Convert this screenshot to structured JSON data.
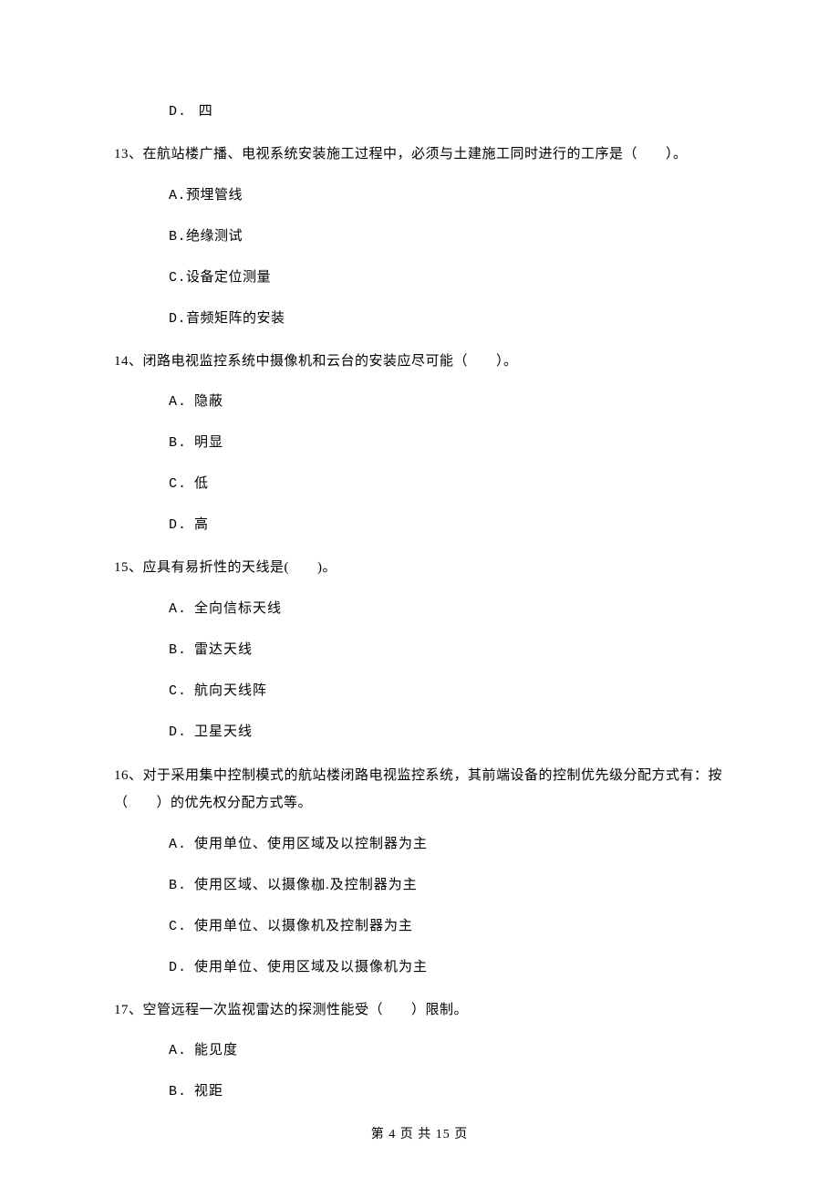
{
  "orphan_option": {
    "label": "D.",
    "text": "四"
  },
  "questions": [
    {
      "number": "13、",
      "text": "在航站楼广播、电视系统安装施工过程中，必须与土建施工同时进行的工序是（　　）。",
      "options": [
        {
          "label": "A.",
          "text": "预埋管线",
          "nospace": true
        },
        {
          "label": "B.",
          "text": "绝缘测试",
          "nospace": true
        },
        {
          "label": "C.",
          "text": "设备定位测量",
          "nospace": true
        },
        {
          "label": "D.",
          "text": "音频矩阵的安装",
          "nospace": true
        }
      ]
    },
    {
      "number": "14、",
      "text": "闭路电视监控系统中摄像机和云台的安装应尽可能（　　）。",
      "options": [
        {
          "label": "A.",
          "text": "隐蔽"
        },
        {
          "label": "B.",
          "text": "明显"
        },
        {
          "label": "C.",
          "text": "低"
        },
        {
          "label": "D.",
          "text": "高"
        }
      ]
    },
    {
      "number": "15、",
      "text": "应具有易折性的天线是(　　)。",
      "options": [
        {
          "label": "A.",
          "text": "全向信标天线"
        },
        {
          "label": "B.",
          "text": "雷达天线"
        },
        {
          "label": "C.",
          "text": "航向天线阵"
        },
        {
          "label": "D.",
          "text": "卫星天线"
        }
      ]
    },
    {
      "number": "16、",
      "text": "对于采用集中控制模式的航站楼闭路电视监控系统，其前端设备的控制优先级分配方式有：按（　　）的优先权分配方式等。",
      "multi": true,
      "options": [
        {
          "label": "A.",
          "text": "使用单位、使用区域及以控制器为主"
        },
        {
          "label": "B.",
          "text": "使用区域、以摄像枷.及控制器为主"
        },
        {
          "label": "C.",
          "text": "使用单位、以摄像机及控制器为主"
        },
        {
          "label": "D.",
          "text": "使用单位、使用区域及以摄像机为主"
        }
      ]
    },
    {
      "number": "17、",
      "text": "空管远程一次监视雷达的探测性能受（　　）限制。",
      "options": [
        {
          "label": "A.",
          "text": "能见度"
        },
        {
          "label": "B.",
          "text": "视距"
        }
      ]
    }
  ],
  "footer": "第 4 页 共 15 页"
}
